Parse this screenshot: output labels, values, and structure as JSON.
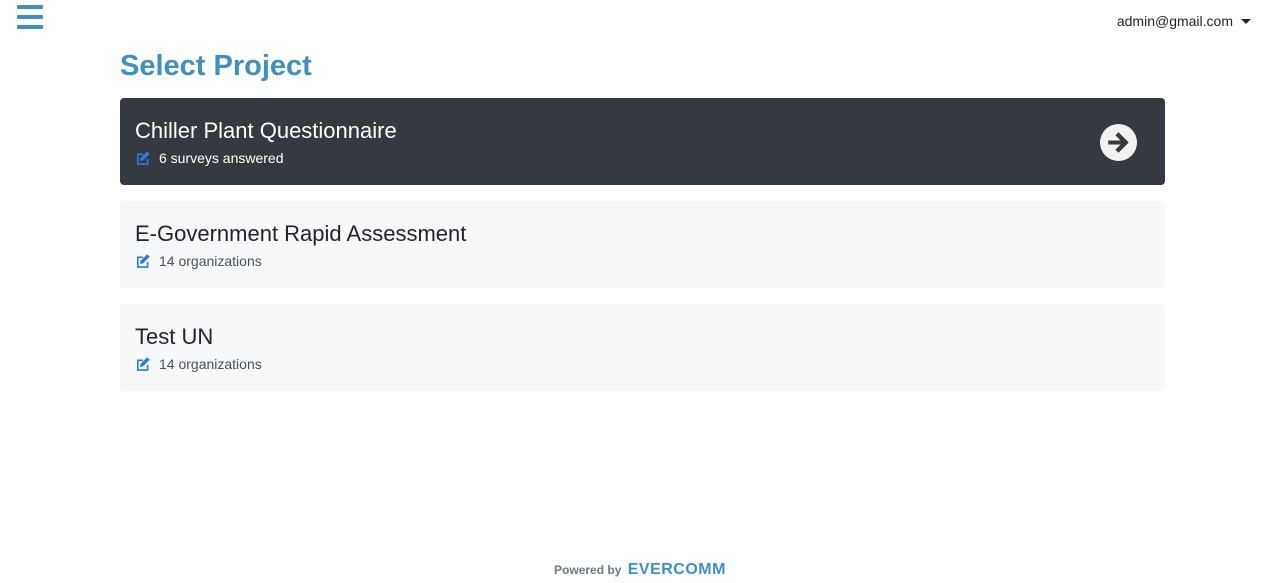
{
  "header": {
    "menu_icon": "hamburger-icon",
    "user_email": "admin@gmail.com"
  },
  "page_title": "Select Project",
  "projects": [
    {
      "name": "Chiller Plant Questionnaire",
      "meta": "6 surveys answered",
      "active": true
    },
    {
      "name": "E-Government Rapid Assessment",
      "meta": "14 organizations",
      "active": false
    },
    {
      "name": "Test UN",
      "meta": "14 organizations",
      "active": false
    }
  ],
  "icons": {
    "meta": "edit-icon",
    "go": "arrow-circle-right-icon"
  },
  "footer": {
    "powered_by": "Powered by",
    "brand": "EVERCOMM"
  },
  "colors": {
    "accent": "#3f8fc0",
    "active_card": "#343a40",
    "card": "#f7f8f9",
    "edit_icon": "#2b7be4"
  }
}
